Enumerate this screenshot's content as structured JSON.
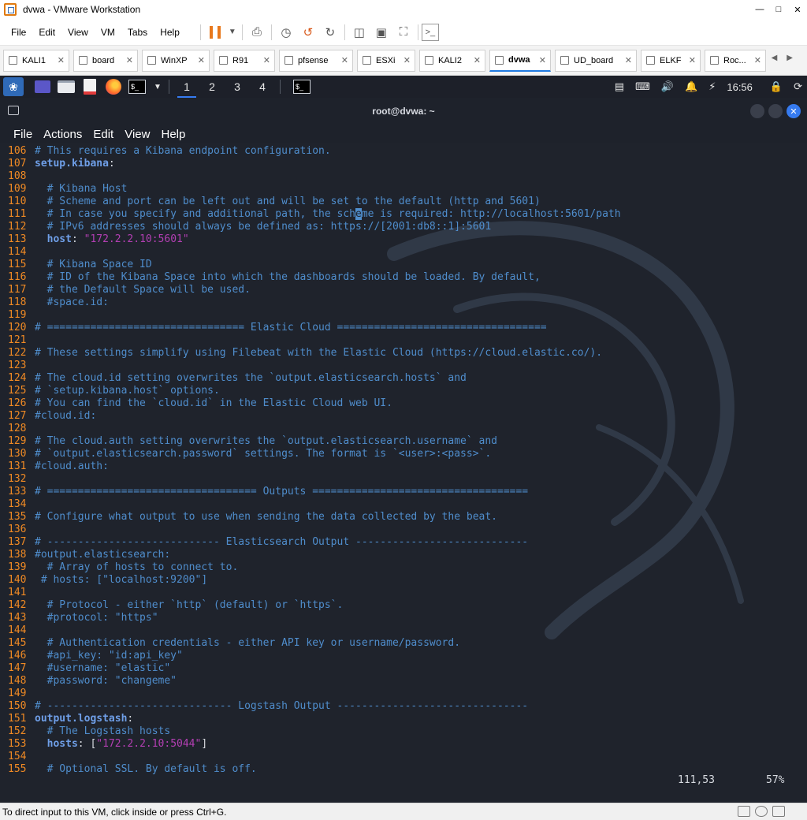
{
  "vmware": {
    "window_title": "dvwa - VMware Workstation",
    "menus": [
      "File",
      "Edit",
      "View",
      "VM",
      "Tabs",
      "Help"
    ],
    "tabs": [
      {
        "label": "KALI1",
        "active": false
      },
      {
        "label": "board",
        "active": false
      },
      {
        "label": "WinXP",
        "active": false
      },
      {
        "label": "R91",
        "active": false
      },
      {
        "label": "pfsense",
        "active": false
      },
      {
        "label": "ESXi",
        "active": false
      },
      {
        "label": "KALI2",
        "active": false
      },
      {
        "label": "dvwa",
        "active": true
      },
      {
        "label": "UD_board",
        "active": false
      },
      {
        "label": "ELKF",
        "active": false
      },
      {
        "label": "Roc...",
        "active": false
      }
    ],
    "status_message": "To direct input to this VM, click inside or press Ctrl+G."
  },
  "kali_panel": {
    "workspaces": [
      "1",
      "2",
      "3",
      "4"
    ],
    "active_workspace": "1",
    "clock": "16:56"
  },
  "terminal": {
    "title": "root@dvwa: ~",
    "menus": [
      "File",
      "Actions",
      "Edit",
      "View",
      "Help"
    ],
    "cursor_position": "111,53",
    "scroll_percent": "57%",
    "lines": [
      {
        "n": "106",
        "segments": [
          {
            "t": "cm",
            "s": "# This requires a Kibana endpoint configuration."
          }
        ]
      },
      {
        "n": "107",
        "segments": [
          {
            "t": "kw",
            "s": "setup.kibana"
          },
          {
            "t": "pl",
            "s": ":"
          }
        ]
      },
      {
        "n": "108",
        "segments": []
      },
      {
        "n": "109",
        "segments": [
          {
            "t": "cm",
            "s": "  # Kibana Host"
          }
        ]
      },
      {
        "n": "110",
        "segments": [
          {
            "t": "cm",
            "s": "  # Scheme and port can be left out and will be set to the default (http and 5601)"
          }
        ]
      },
      {
        "n": "111",
        "segments": [
          {
            "t": "cm",
            "s": "  # In case you specify and additional path, the sch"
          },
          {
            "t": "cursor",
            "s": "e"
          },
          {
            "t": "cm",
            "s": "me is required: http://localhost:5601/path"
          }
        ]
      },
      {
        "n": "112",
        "segments": [
          {
            "t": "cm",
            "s": "  # IPv6 addresses should always be defined as: https://[2001:db8::1]:5601"
          }
        ]
      },
      {
        "n": "113",
        "segments": [
          {
            "t": "kw",
            "s": "  host"
          },
          {
            "t": "pl",
            "s": ": "
          },
          {
            "t": "st",
            "s": "\"172.2.2.10:5601\""
          }
        ]
      },
      {
        "n": "114",
        "segments": []
      },
      {
        "n": "115",
        "segments": [
          {
            "t": "cm",
            "s": "  # Kibana Space ID"
          }
        ]
      },
      {
        "n": "116",
        "segments": [
          {
            "t": "cm",
            "s": "  # ID of the Kibana Space into which the dashboards should be loaded. By default,"
          }
        ]
      },
      {
        "n": "117",
        "segments": [
          {
            "t": "cm",
            "s": "  # the Default Space will be used."
          }
        ]
      },
      {
        "n": "118",
        "segments": [
          {
            "t": "cm",
            "s": "  #space.id:"
          }
        ]
      },
      {
        "n": "119",
        "segments": []
      },
      {
        "n": "120",
        "segments": [
          {
            "t": "cm",
            "s": "# ================================ Elastic Cloud =================================="
          }
        ]
      },
      {
        "n": "121",
        "segments": []
      },
      {
        "n": "122",
        "segments": [
          {
            "t": "cm",
            "s": "# These settings simplify using Filebeat with the Elastic Cloud (https://cloud.elastic.co/)."
          }
        ]
      },
      {
        "n": "123",
        "segments": []
      },
      {
        "n": "124",
        "segments": [
          {
            "t": "cm",
            "s": "# The cloud.id setting overwrites the `output.elasticsearch.hosts` and"
          }
        ]
      },
      {
        "n": "125",
        "segments": [
          {
            "t": "cm",
            "s": "# `setup.kibana.host` options."
          }
        ]
      },
      {
        "n": "126",
        "segments": [
          {
            "t": "cm",
            "s": "# You can find the `cloud.id` in the Elastic Cloud web UI."
          }
        ]
      },
      {
        "n": "127",
        "segments": [
          {
            "t": "cm",
            "s": "#cloud.id:"
          }
        ]
      },
      {
        "n": "128",
        "segments": []
      },
      {
        "n": "129",
        "segments": [
          {
            "t": "cm",
            "s": "# The cloud.auth setting overwrites the `output.elasticsearch.username` and"
          }
        ]
      },
      {
        "n": "130",
        "segments": [
          {
            "t": "cm",
            "s": "# `output.elasticsearch.password` settings. The format is `<user>:<pass>`."
          }
        ]
      },
      {
        "n": "131",
        "segments": [
          {
            "t": "cm",
            "s": "#cloud.auth:"
          }
        ]
      },
      {
        "n": "132",
        "segments": []
      },
      {
        "n": "133",
        "segments": [
          {
            "t": "cm",
            "s": "# ================================== Outputs ==================================="
          }
        ]
      },
      {
        "n": "134",
        "segments": []
      },
      {
        "n": "135",
        "segments": [
          {
            "t": "cm",
            "s": "# Configure what output to use when sending the data collected by the beat."
          }
        ]
      },
      {
        "n": "136",
        "segments": []
      },
      {
        "n": "137",
        "segments": [
          {
            "t": "cm",
            "s": "# ---------------------------- Elasticsearch Output ----------------------------"
          }
        ]
      },
      {
        "n": "138",
        "segments": [
          {
            "t": "cm",
            "s": "#output.elasticsearch:"
          }
        ]
      },
      {
        "n": "139",
        "segments": [
          {
            "t": "cm",
            "s": "  # Array of hosts to connect to."
          }
        ]
      },
      {
        "n": "140",
        "segments": [
          {
            "t": "cm",
            "s": " # hosts: [\"localhost:9200\"]"
          }
        ]
      },
      {
        "n": "141",
        "segments": []
      },
      {
        "n": "142",
        "segments": [
          {
            "t": "cm",
            "s": "  # Protocol - either `http` (default) or `https`."
          }
        ]
      },
      {
        "n": "143",
        "segments": [
          {
            "t": "cm",
            "s": "  #protocol: \"https\""
          }
        ]
      },
      {
        "n": "144",
        "segments": []
      },
      {
        "n": "145",
        "segments": [
          {
            "t": "cm",
            "s": "  # Authentication credentials - either API key or username/password."
          }
        ]
      },
      {
        "n": "146",
        "segments": [
          {
            "t": "cm",
            "s": "  #api_key: \"id:api_key\""
          }
        ]
      },
      {
        "n": "147",
        "segments": [
          {
            "t": "cm",
            "s": "  #username: \"elastic\""
          }
        ]
      },
      {
        "n": "148",
        "segments": [
          {
            "t": "cm",
            "s": "  #password: \"changeme\""
          }
        ]
      },
      {
        "n": "149",
        "segments": []
      },
      {
        "n": "150",
        "segments": [
          {
            "t": "cm",
            "s": "# ------------------------------ Logstash Output -------------------------------"
          }
        ]
      },
      {
        "n": "151",
        "segments": [
          {
            "t": "kw",
            "s": "output.logstash"
          },
          {
            "t": "pl",
            "s": ":"
          }
        ]
      },
      {
        "n": "152",
        "segments": [
          {
            "t": "cm",
            "s": "  # The Logstash hosts"
          }
        ]
      },
      {
        "n": "153",
        "segments": [
          {
            "t": "kw",
            "s": "  hosts"
          },
          {
            "t": "pl",
            "s": ": ["
          },
          {
            "t": "st",
            "s": "\"172.2.2.10:5044\""
          },
          {
            "t": "pl",
            "s": "]"
          }
        ]
      },
      {
        "n": "154",
        "segments": []
      },
      {
        "n": "155",
        "segments": [
          {
            "t": "cm",
            "s": "  # Optional SSL. By default is off."
          }
        ]
      }
    ]
  }
}
